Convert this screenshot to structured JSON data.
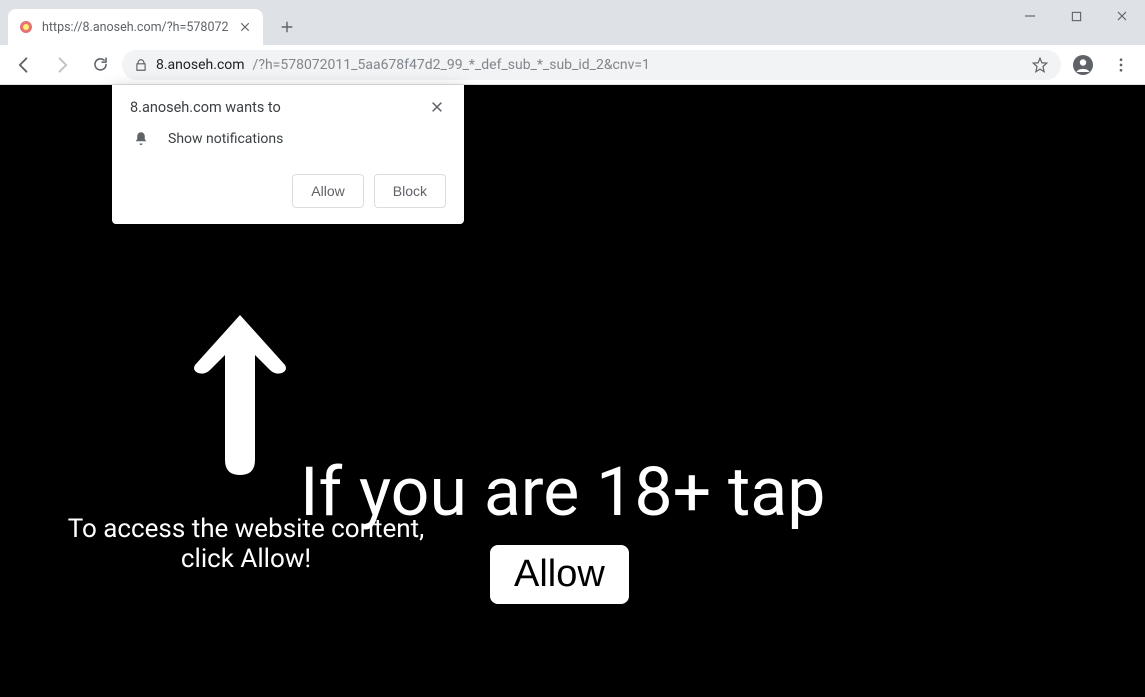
{
  "window": {
    "tab_title": "https://8.anoseh.com/?h=578072"
  },
  "addressbar": {
    "host": "8.anoseh.com",
    "path": "/?h=578072011_5aa678f47d2_99_*_def_sub_*_sub_id_2&cnv=1"
  },
  "permission": {
    "title": "8.anoseh.com wants to",
    "item": "Show notifications",
    "allow": "Allow",
    "block": "Block"
  },
  "page": {
    "arrow_text_line1": "To access the website content,",
    "arrow_text_line2": "click Allow!",
    "age_text": "If you are 18+ tap",
    "allow_button": "Allow"
  }
}
